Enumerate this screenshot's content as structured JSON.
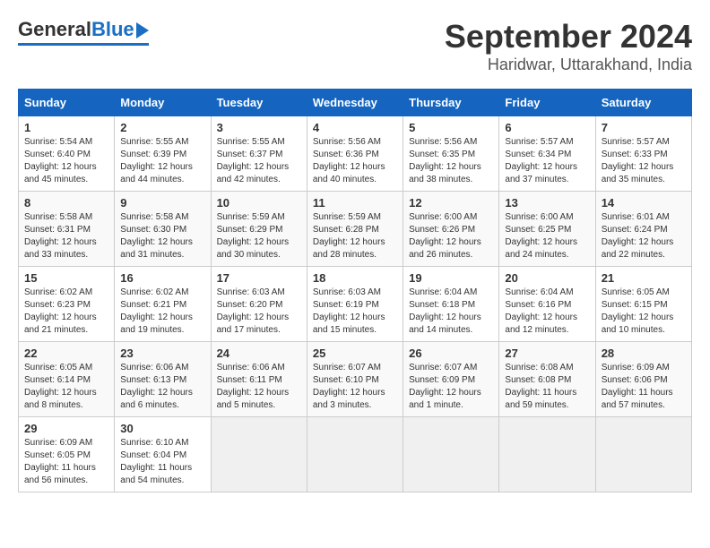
{
  "header": {
    "logo_general": "General",
    "logo_blue": "Blue",
    "title": "September 2024",
    "subtitle": "Haridwar, Uttarakhand, India"
  },
  "calendar": {
    "columns": [
      "Sunday",
      "Monday",
      "Tuesday",
      "Wednesday",
      "Thursday",
      "Friday",
      "Saturday"
    ],
    "weeks": [
      [
        {
          "day": "",
          "sunrise": "",
          "sunset": "",
          "daylight": "",
          "empty": true
        },
        {
          "day": "",
          "sunrise": "",
          "sunset": "",
          "daylight": "",
          "empty": true
        },
        {
          "day": "",
          "sunrise": "",
          "sunset": "",
          "daylight": "",
          "empty": true
        },
        {
          "day": "",
          "sunrise": "",
          "sunset": "",
          "daylight": "",
          "empty": true
        },
        {
          "day": "",
          "sunrise": "",
          "sunset": "",
          "daylight": "",
          "empty": true
        },
        {
          "day": "",
          "sunrise": "",
          "sunset": "",
          "daylight": "",
          "empty": true
        },
        {
          "day": "",
          "sunrise": "",
          "sunset": "",
          "daylight": "",
          "empty": true
        }
      ],
      [
        {
          "day": "1",
          "sunrise": "Sunrise: 5:54 AM",
          "sunset": "Sunset: 6:40 PM",
          "daylight": "Daylight: 12 hours and 45 minutes."
        },
        {
          "day": "2",
          "sunrise": "Sunrise: 5:55 AM",
          "sunset": "Sunset: 6:39 PM",
          "daylight": "Daylight: 12 hours and 44 minutes."
        },
        {
          "day": "3",
          "sunrise": "Sunrise: 5:55 AM",
          "sunset": "Sunset: 6:37 PM",
          "daylight": "Daylight: 12 hours and 42 minutes."
        },
        {
          "day": "4",
          "sunrise": "Sunrise: 5:56 AM",
          "sunset": "Sunset: 6:36 PM",
          "daylight": "Daylight: 12 hours and 40 minutes."
        },
        {
          "day": "5",
          "sunrise": "Sunrise: 5:56 AM",
          "sunset": "Sunset: 6:35 PM",
          "daylight": "Daylight: 12 hours and 38 minutes."
        },
        {
          "day": "6",
          "sunrise": "Sunrise: 5:57 AM",
          "sunset": "Sunset: 6:34 PM",
          "daylight": "Daylight: 12 hours and 37 minutes."
        },
        {
          "day": "7",
          "sunrise": "Sunrise: 5:57 AM",
          "sunset": "Sunset: 6:33 PM",
          "daylight": "Daylight: 12 hours and 35 minutes."
        }
      ],
      [
        {
          "day": "8",
          "sunrise": "Sunrise: 5:58 AM",
          "sunset": "Sunset: 6:31 PM",
          "daylight": "Daylight: 12 hours and 33 minutes."
        },
        {
          "day": "9",
          "sunrise": "Sunrise: 5:58 AM",
          "sunset": "Sunset: 6:30 PM",
          "daylight": "Daylight: 12 hours and 31 minutes."
        },
        {
          "day": "10",
          "sunrise": "Sunrise: 5:59 AM",
          "sunset": "Sunset: 6:29 PM",
          "daylight": "Daylight: 12 hours and 30 minutes."
        },
        {
          "day": "11",
          "sunrise": "Sunrise: 5:59 AM",
          "sunset": "Sunset: 6:28 PM",
          "daylight": "Daylight: 12 hours and 28 minutes."
        },
        {
          "day": "12",
          "sunrise": "Sunrise: 6:00 AM",
          "sunset": "Sunset: 6:26 PM",
          "daylight": "Daylight: 12 hours and 26 minutes."
        },
        {
          "day": "13",
          "sunrise": "Sunrise: 6:00 AM",
          "sunset": "Sunset: 6:25 PM",
          "daylight": "Daylight: 12 hours and 24 minutes."
        },
        {
          "day": "14",
          "sunrise": "Sunrise: 6:01 AM",
          "sunset": "Sunset: 6:24 PM",
          "daylight": "Daylight: 12 hours and 22 minutes."
        }
      ],
      [
        {
          "day": "15",
          "sunrise": "Sunrise: 6:02 AM",
          "sunset": "Sunset: 6:23 PM",
          "daylight": "Daylight: 12 hours and 21 minutes."
        },
        {
          "day": "16",
          "sunrise": "Sunrise: 6:02 AM",
          "sunset": "Sunset: 6:21 PM",
          "daylight": "Daylight: 12 hours and 19 minutes."
        },
        {
          "day": "17",
          "sunrise": "Sunrise: 6:03 AM",
          "sunset": "Sunset: 6:20 PM",
          "daylight": "Daylight: 12 hours and 17 minutes."
        },
        {
          "day": "18",
          "sunrise": "Sunrise: 6:03 AM",
          "sunset": "Sunset: 6:19 PM",
          "daylight": "Daylight: 12 hours and 15 minutes."
        },
        {
          "day": "19",
          "sunrise": "Sunrise: 6:04 AM",
          "sunset": "Sunset: 6:18 PM",
          "daylight": "Daylight: 12 hours and 14 minutes."
        },
        {
          "day": "20",
          "sunrise": "Sunrise: 6:04 AM",
          "sunset": "Sunset: 6:16 PM",
          "daylight": "Daylight: 12 hours and 12 minutes."
        },
        {
          "day": "21",
          "sunrise": "Sunrise: 6:05 AM",
          "sunset": "Sunset: 6:15 PM",
          "daylight": "Daylight: 12 hours and 10 minutes."
        }
      ],
      [
        {
          "day": "22",
          "sunrise": "Sunrise: 6:05 AM",
          "sunset": "Sunset: 6:14 PM",
          "daylight": "Daylight: 12 hours and 8 minutes."
        },
        {
          "day": "23",
          "sunrise": "Sunrise: 6:06 AM",
          "sunset": "Sunset: 6:13 PM",
          "daylight": "Daylight: 12 hours and 6 minutes."
        },
        {
          "day": "24",
          "sunrise": "Sunrise: 6:06 AM",
          "sunset": "Sunset: 6:11 PM",
          "daylight": "Daylight: 12 hours and 5 minutes."
        },
        {
          "day": "25",
          "sunrise": "Sunrise: 6:07 AM",
          "sunset": "Sunset: 6:10 PM",
          "daylight": "Daylight: 12 hours and 3 minutes."
        },
        {
          "day": "26",
          "sunrise": "Sunrise: 6:07 AM",
          "sunset": "Sunset: 6:09 PM",
          "daylight": "Daylight: 12 hours and 1 minute."
        },
        {
          "day": "27",
          "sunrise": "Sunrise: 6:08 AM",
          "sunset": "Sunset: 6:08 PM",
          "daylight": "Daylight: 11 hours and 59 minutes."
        },
        {
          "day": "28",
          "sunrise": "Sunrise: 6:09 AM",
          "sunset": "Sunset: 6:06 PM",
          "daylight": "Daylight: 11 hours and 57 minutes."
        }
      ],
      [
        {
          "day": "29",
          "sunrise": "Sunrise: 6:09 AM",
          "sunset": "Sunset: 6:05 PM",
          "daylight": "Daylight: 11 hours and 56 minutes."
        },
        {
          "day": "30",
          "sunrise": "Sunrise: 6:10 AM",
          "sunset": "Sunset: 6:04 PM",
          "daylight": "Daylight: 11 hours and 54 minutes."
        },
        {
          "day": "",
          "sunrise": "",
          "sunset": "",
          "daylight": "",
          "empty": true
        },
        {
          "day": "",
          "sunrise": "",
          "sunset": "",
          "daylight": "",
          "empty": true
        },
        {
          "day": "",
          "sunrise": "",
          "sunset": "",
          "daylight": "",
          "empty": true
        },
        {
          "day": "",
          "sunrise": "",
          "sunset": "",
          "daylight": "",
          "empty": true
        },
        {
          "day": "",
          "sunrise": "",
          "sunset": "",
          "daylight": "",
          "empty": true
        }
      ]
    ]
  }
}
